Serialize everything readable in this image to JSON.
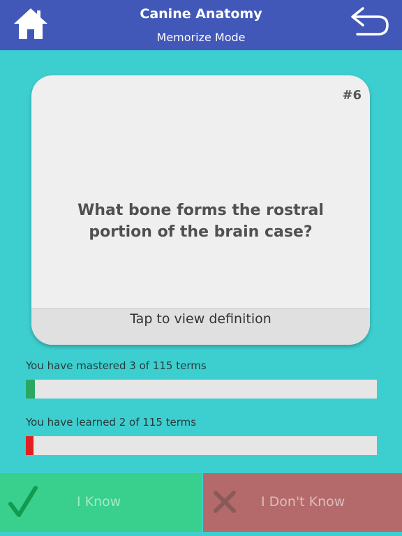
{
  "header": {
    "title": "Canine Anatomy",
    "subtitle": "Memorize Mode",
    "home_icon": "home-icon",
    "back_icon": "return-arrow-icon",
    "background_color": "#4258b8"
  },
  "card": {
    "number": "#6",
    "question": "What bone forms the rostral portion of the brain case?",
    "footer_label": "Tap to view definition"
  },
  "progress": {
    "mastered": {
      "label": "You have mastered 3 of 115 terms",
      "count": 3,
      "total": 115,
      "color": "#2aa862"
    },
    "learned": {
      "label": "You have learned 2 of 115 terms",
      "count": 2,
      "total": 115,
      "color": "#e02020"
    }
  },
  "actions": {
    "know_label": "I Know",
    "know_icon": "checkmark-icon",
    "know_color": "#39cf8c",
    "dont_know_label": "I Don't Know",
    "dont_know_icon": "x-icon",
    "dont_know_color": "#b46a6a"
  },
  "background_color": "#3dcfcf"
}
